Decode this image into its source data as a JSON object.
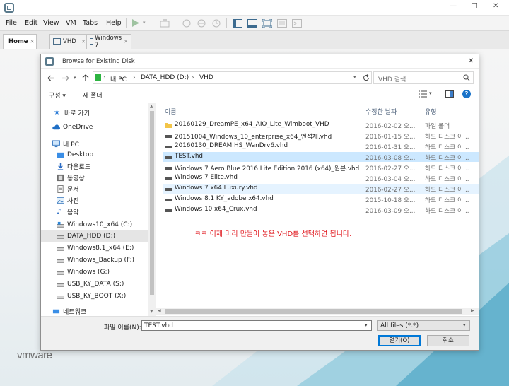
{
  "window": {
    "controls": {
      "minimize": "—",
      "maximize": "☐",
      "close": "✕"
    }
  },
  "menu": [
    "File",
    "Edit",
    "View",
    "VM",
    "Tabs",
    "Help"
  ],
  "tabs": [
    {
      "label": "Home",
      "active": true
    },
    {
      "label": "VHD",
      "active": false
    },
    {
      "label": "Windows 7",
      "active": false
    }
  ],
  "brand": {
    "logo": "vmware"
  },
  "dialog": {
    "title": "Browse for Existing Disk",
    "close": "✕",
    "breadcrumb": [
      "내 PC",
      "DATA_HDD (D:)",
      "VHD"
    ],
    "search_placeholder": "VHD 검색",
    "toolbar": {
      "organize": "구성 ▾",
      "new_folder": "새 폴더"
    },
    "nav": [
      {
        "label": "바로 가기",
        "icon": "star-icon"
      },
      {
        "label": "OneDrive",
        "icon": "cloud-icon"
      },
      {
        "label": "내 PC",
        "icon": "computer-icon"
      },
      {
        "label": "Desktop",
        "icon": "desktop-icon"
      },
      {
        "label": "다운로드",
        "icon": "download-icon"
      },
      {
        "label": "동영상",
        "icon": "video-icon"
      },
      {
        "label": "문서",
        "icon": "document-icon"
      },
      {
        "label": "사진",
        "icon": "picture-icon"
      },
      {
        "label": "음악",
        "icon": "music-icon"
      },
      {
        "label": "Windows10_x64 (C:)",
        "icon": "drive-icon"
      },
      {
        "label": "DATA_HDD (D:)",
        "icon": "drive-icon",
        "selected": true
      },
      {
        "label": "Windows8.1_x64 (E:)",
        "icon": "drive-icon"
      },
      {
        "label": "Windows_Backup (F:)",
        "icon": "drive-icon"
      },
      {
        "label": "Windows (G:)",
        "icon": "drive-icon"
      },
      {
        "label": "USB_KY_DATA (S:)",
        "icon": "drive-icon"
      },
      {
        "label": "USB_KY_BOOT (X:)",
        "icon": "drive-icon"
      },
      {
        "label": "네트워크",
        "icon": "network-icon"
      }
    ],
    "columns": {
      "name": "이름",
      "date": "수정한 날짜",
      "type": "유형"
    },
    "files": [
      {
        "name": "20160129_DreamPE_x64_AIO_Lite_Wimboot_VHD",
        "date": "2016-02-02 오...",
        "type": "파일 폴더",
        "kind": "folder"
      },
      {
        "name": "20151004_Windows_10_enterprise_x64_엔석체.vhd",
        "date": "2016-01-15 오...",
        "type": "하드 디스크 이...",
        "kind": "vhd"
      },
      {
        "name": "20160130_DREAM HS_WanDrv6.vhd",
        "date": "2016-01-31 오...",
        "type": "하드 디스크 이...",
        "kind": "vhd"
      },
      {
        "name": "TEST.vhd",
        "date": "2016-03-08 오...",
        "type": "하드 디스크 이...",
        "kind": "vhd",
        "selected": true
      },
      {
        "name": "Windows 7 Aero Blue 2016 Lite Edition 2016 (x64)_원본.vhd",
        "date": "2016-02-27 오...",
        "type": "하드 디스크 이...",
        "kind": "vhd"
      },
      {
        "name": "Windows 7 Elite.vhd",
        "date": "2016-03-04 오...",
        "type": "하드 디스크 이...",
        "kind": "vhd"
      },
      {
        "name": "Windows 7 x64 Luxury.vhd",
        "date": "2016-02-27 오...",
        "type": "하드 디스크 이...",
        "kind": "vhd",
        "hover": true
      },
      {
        "name": "Windows 8.1 KY_adobe x64.vhd",
        "date": "2015-10-18 오...",
        "type": "하드 디스크 이...",
        "kind": "vhd"
      },
      {
        "name": "Windows 10 x64_Crux.vhd",
        "date": "2016-03-09 오...",
        "type": "하드 디스크 이...",
        "kind": "vhd"
      }
    ],
    "annotation": "ㅋㅋ 이제 미리 만들어 놓은 VHD를 선택하면 됩니다.",
    "filename_label": "파일 이름(N):",
    "filename_value": "TEST.vhd",
    "filter_value": "All files (*.*)",
    "open_button": "열기(O)",
    "cancel_button": "취소"
  },
  "colors": {
    "selected_row": "#cce8ff",
    "annotation": "#e0161c",
    "accent": "#0078d7"
  }
}
